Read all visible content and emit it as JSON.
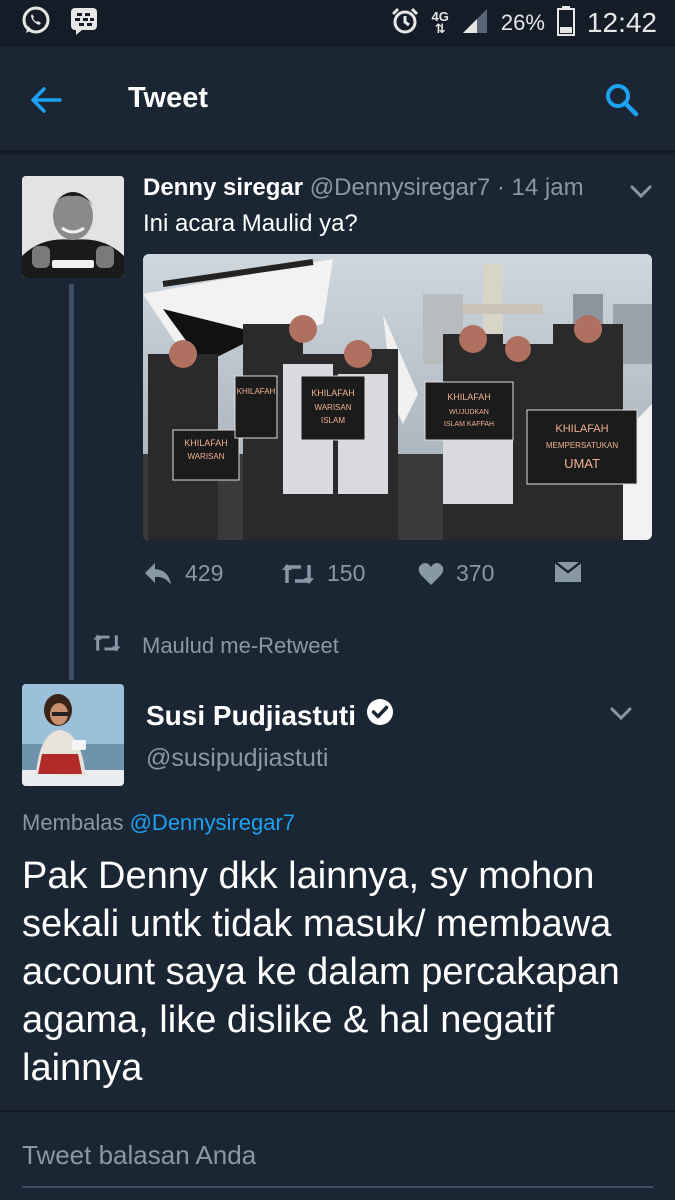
{
  "status_bar": {
    "network_top": "4G",
    "network_bottom": "⇅",
    "battery": "26%",
    "time": "12:42",
    "icons": [
      "whatsapp-icon",
      "bbm-icon",
      "alarm-icon",
      "signal-icon",
      "battery-icon"
    ]
  },
  "app_bar": {
    "title": "Tweet",
    "icons": [
      "back-arrow-icon",
      "search-icon"
    ],
    "accent_color": "#1da1f2"
  },
  "tweet1": {
    "name": "Denny siregar",
    "handle": "@Dennysiregar7",
    "time": " · 14 jam",
    "text": "Ini acara Maulid ya?",
    "photo_signs": [
      "KHILAFAH WARISAN",
      "KHILAFAH WARISAN ISLAM",
      "KHILAFAH WUJUDKAN ISLAM KAFFAH",
      "KHILAFAH MEMPERSATUKAN UMAT"
    ],
    "replies": "429",
    "retweets": "150",
    "likes": "370"
  },
  "retweet_notice": "Maulud me-Retweet",
  "tweet2": {
    "name": "Susi Pudjiastuti",
    "handle": "@susipudjiastuti",
    "replying_prefix": "Membalas ",
    "replying_to": "@Dennysiregar7",
    "text": "Pak Denny dkk lainnya, sy mohon sekali untk tidak masuk/ membawa account saya ke dalam percakapan agama, like dislike & hal negatif lainnya"
  },
  "reply_placeholder": "Tweet balasan Anda",
  "colors": {
    "background": "#1b2634",
    "status_bar": "#141c27",
    "muted_text": "#8899a6",
    "link": "#1da1f2"
  }
}
